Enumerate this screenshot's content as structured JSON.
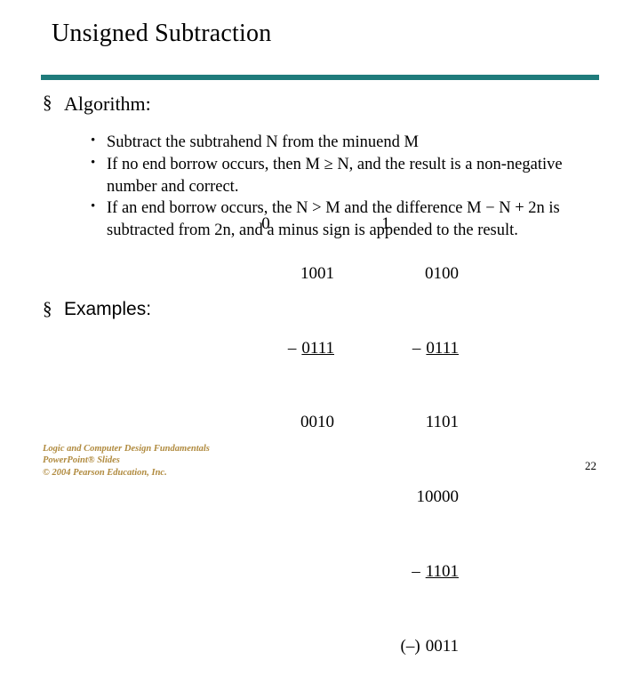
{
  "slide": {
    "title": "Unsigned Subtraction",
    "page_number": "22",
    "accent_color": "#1f7b7b",
    "footer": {
      "line1": "Logic and Computer Design Fundamentals",
      "line2": "PowerPoint® Slides",
      "line3": "© 2004 Pearson Education, Inc."
    },
    "bullets": {
      "algorithm_label": "Algorithm:",
      "examples_label": "Examples:",
      "bullet_lvl1": "§",
      "bullet_lvl2": "•",
      "items": [
        "Subtract the subtrahend N from the minuend M",
        "If no end borrow occurs, then M ≥ N, and the result is a non-negative number and correct.",
        "If an end borrow occurs, the N > M and the difference M − N + 2n is subtracted from 2n, and a minus sign is appended to the result."
      ]
    },
    "examples": {
      "left": {
        "borrow": "0",
        "rows": [
          {
            "op": "",
            "digits": "1001",
            "underline": false
          },
          {
            "op": "–",
            "digits": "0111",
            "underline": true
          },
          {
            "op": "",
            "digits": "0010",
            "underline": false
          }
        ]
      },
      "right": {
        "borrow": "1",
        "rows": [
          {
            "op": "",
            "digits": "0100",
            "underline": false
          },
          {
            "op": "–",
            "digits": "0111",
            "underline": true
          },
          {
            "op": "",
            "digits": "1101",
            "underline": false
          },
          {
            "op": "",
            "digits": "10000",
            "underline": false
          },
          {
            "op": "–",
            "digits": "1101",
            "underline": true
          },
          {
            "op": "(–)",
            "digits": "0011",
            "underline": false
          }
        ]
      }
    }
  }
}
